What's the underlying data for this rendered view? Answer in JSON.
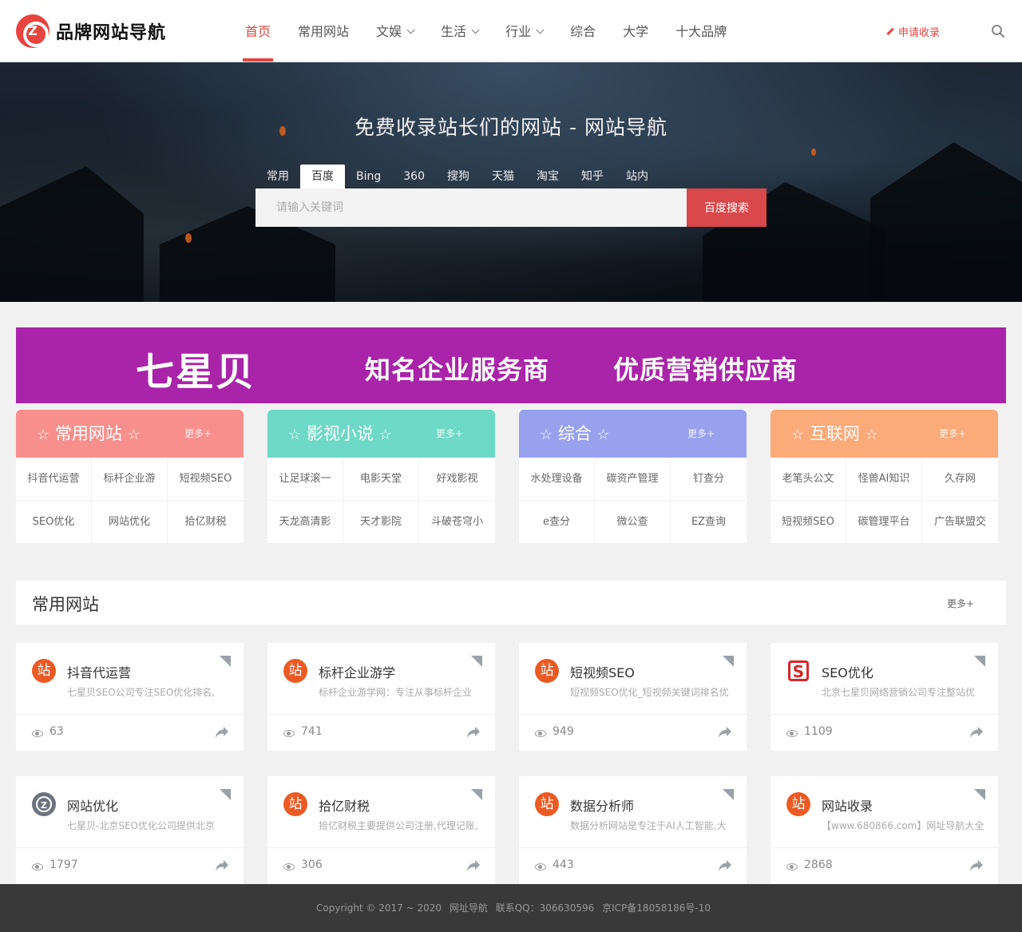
{
  "brand": {
    "name": "品牌网站导航"
  },
  "nav": {
    "items": [
      {
        "label": "首页",
        "dropdown": false,
        "active": true
      },
      {
        "label": "常用网站",
        "dropdown": false
      },
      {
        "label": "文娱",
        "dropdown": true
      },
      {
        "label": "生活",
        "dropdown": true
      },
      {
        "label": "行业",
        "dropdown": true
      },
      {
        "label": "综合",
        "dropdown": false
      },
      {
        "label": "大学",
        "dropdown": false
      },
      {
        "label": "十大品牌",
        "dropdown": false
      }
    ],
    "apply_label": "申请收录"
  },
  "hero": {
    "title": "免费收录站长们的网站 - 网站导航",
    "engines": [
      "常用",
      "百度",
      "Bing",
      "360",
      "搜狗",
      "天猫",
      "淘宝",
      "知乎",
      "站内"
    ],
    "active_engine": "百度",
    "search_placeholder": "请输入关键词",
    "search_button": "百度搜索"
  },
  "banner": {
    "brand": "七星贝",
    "slogan1": "知名企业服务商",
    "slogan2": "优质营销供应商",
    "color": "#a924a8"
  },
  "categories": [
    {
      "title": "常用网站",
      "more": "更多+",
      "color": "#f7908c",
      "links": [
        "抖音代运营",
        "标杆企业游",
        "短视频SEO",
        "SEO优化",
        "网站优化",
        "拾亿财税"
      ]
    },
    {
      "title": "影视小说",
      "more": "更多+",
      "color": "#6ed9c6",
      "links": [
        "让足球滚一",
        "电影天堂",
        "好戏影视",
        "天龙高清影",
        "天才影院",
        "斗破苍穹小"
      ]
    },
    {
      "title": "综合",
      "more": "更多+",
      "color": "#98a1ee",
      "links": [
        "水处理设备",
        "碳资产管理",
        "钉查分",
        "e查分",
        "微公查",
        "EZ查询"
      ]
    },
    {
      "title": "互联网",
      "more": "更多+",
      "color": "#fbaa7a",
      "links": [
        "老笔头公文",
        "怪兽AI知识",
        "久存网",
        "短视频SEO",
        "碳管理平台",
        "广告联盟交"
      ]
    }
  ],
  "section": {
    "title": "常用网站",
    "more": "更多+"
  },
  "sites": [
    {
      "icon": "站",
      "icon_style": "orange",
      "name": "抖音代运营",
      "desc": "七星贝SEO公司专注SEO优化排名,",
      "views": "63"
    },
    {
      "icon": "站",
      "icon_style": "orange",
      "name": "标杆企业游学",
      "desc": "标杆企业游学网：专注从事标杆企业",
      "views": "741"
    },
    {
      "icon": "站",
      "icon_style": "orange",
      "name": "短视频SEO",
      "desc": "短视频SEO优化_短视频关键词排名优",
      "views": "949"
    },
    {
      "icon": "S",
      "icon_style": "sogou",
      "name": "SEO优化",
      "desc": "北京七星贝网络营销公司专注整站优",
      "views": "1109"
    },
    {
      "icon": "Z",
      "icon_style": "gray",
      "name": "网站优化",
      "desc": "七星贝-北京SEO优化公司提供北京",
      "views": "1797"
    },
    {
      "icon": "站",
      "icon_style": "orange",
      "name": "拾亿财税",
      "desc": "拾亿财税主要提供公司注册,代理记账,",
      "views": "306"
    },
    {
      "icon": "站",
      "icon_style": "orange",
      "name": "数据分析师",
      "desc": "数据分析网站是专注于AI人工智能,大",
      "views": "443"
    },
    {
      "icon": "站",
      "icon_style": "orange",
      "name": "网站收录",
      "desc": "【www.680866.com】网址导航大全",
      "views": "2868"
    }
  ],
  "footer": {
    "copyright": "Copyright © 2017 ~ 2020",
    "site": "网址导航",
    "qq": "联系QQ：306630596",
    "icp": "京ICP备18058186号-10"
  }
}
